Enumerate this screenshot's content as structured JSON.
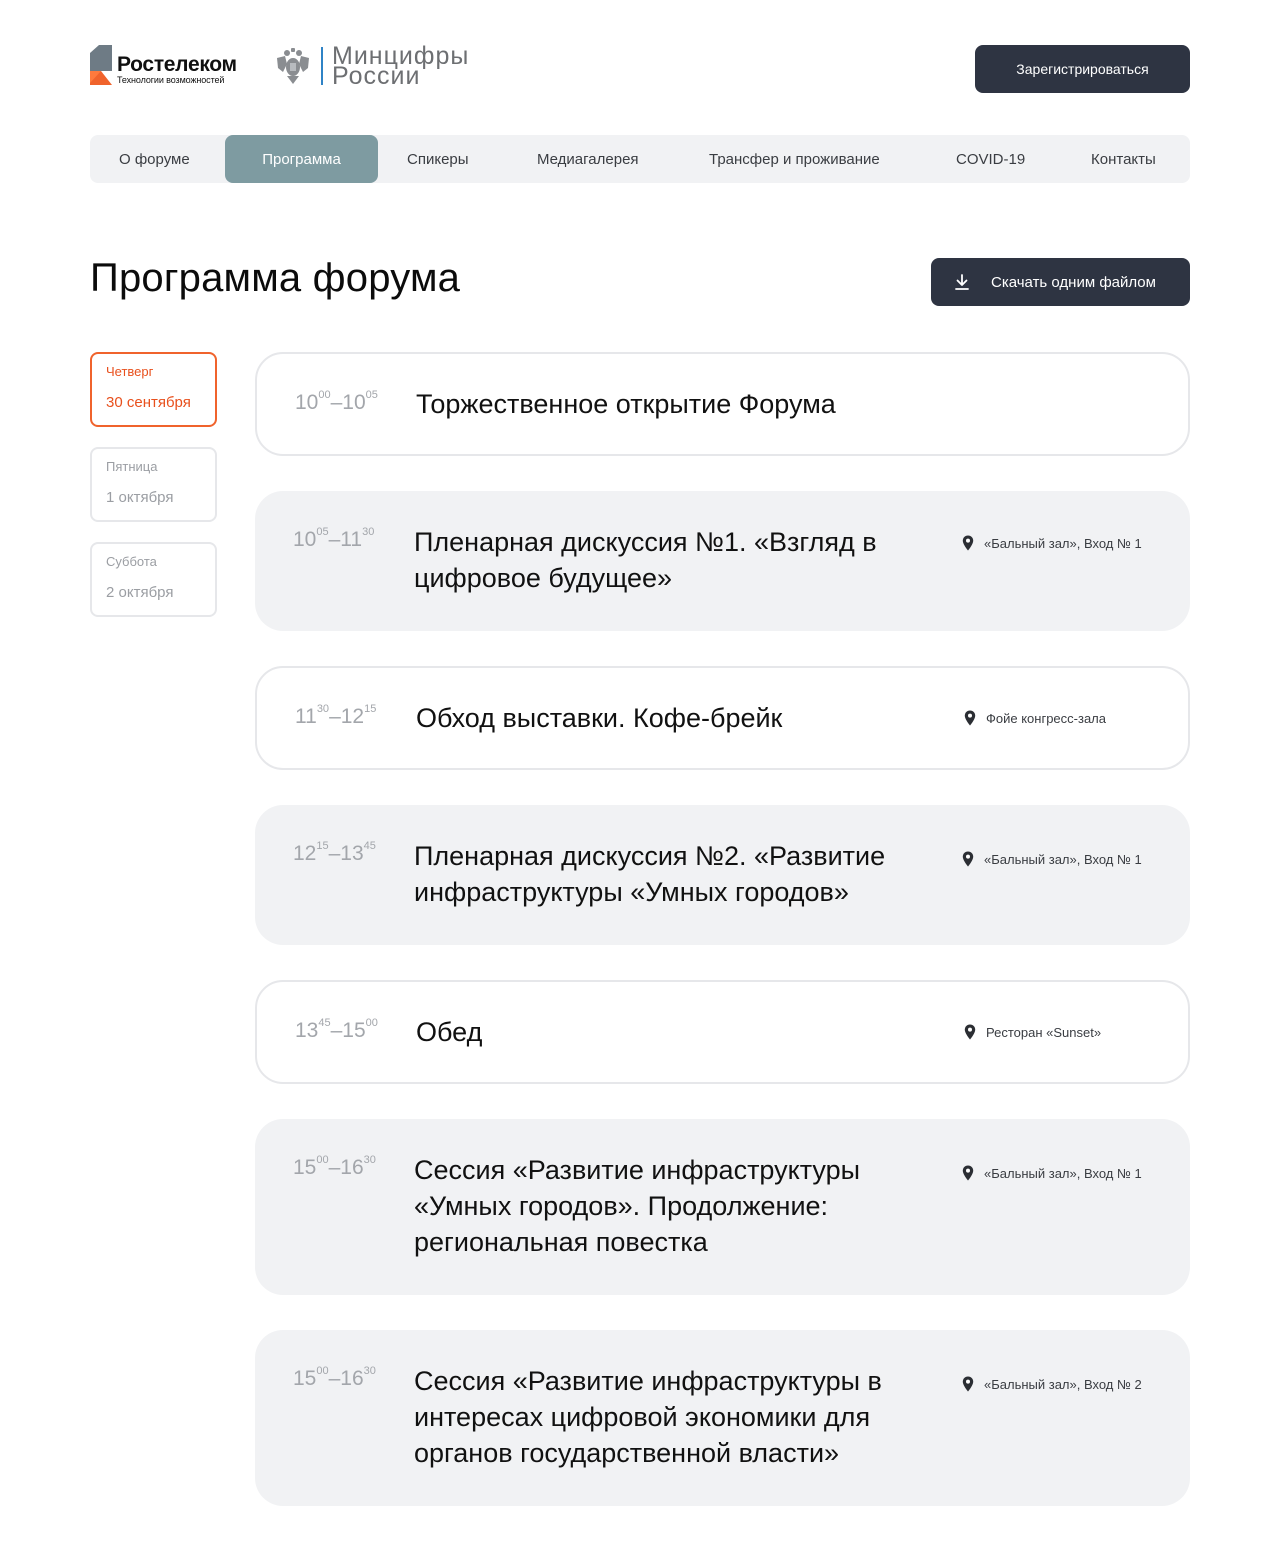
{
  "header": {
    "brand_name": "Ростелеком",
    "brand_tagline": "Технологии возможностей",
    "ministry_line1": "Минцифры",
    "ministry_line2": "России",
    "register_label": "Зарегистрироваться"
  },
  "nav": {
    "items": [
      {
        "label": "О форуме",
        "active": false
      },
      {
        "label": "Программа",
        "active": true
      },
      {
        "label": "Спикеры",
        "active": false
      },
      {
        "label": "Медиагалерея",
        "active": false
      },
      {
        "label": "Трансфер и проживание",
        "active": false
      },
      {
        "label": "COVID-19",
        "active": false
      },
      {
        "label": "Контакты",
        "active": false
      }
    ]
  },
  "page": {
    "title": "Программа форума",
    "download_label": "Скачать одним файлом"
  },
  "days": [
    {
      "weekday": "Четверг",
      "date": "30 сентября",
      "active": true
    },
    {
      "weekday": "Пятница",
      "date": "1 октября",
      "active": false
    },
    {
      "weekday": "Суббота",
      "date": "2 октября",
      "active": false
    }
  ],
  "events": [
    {
      "start_h": "10",
      "start_m": "00",
      "end_h": "10",
      "end_m": "05",
      "title": "Торжественное открытие Форума",
      "location": "",
      "style": "outlined"
    },
    {
      "start_h": "10",
      "start_m": "05",
      "end_h": "11",
      "end_m": "30",
      "title": "Пленарная дискуссия №1. «Взгляд в цифровое будущее»",
      "location": "«Бальный зал», Вход № 1",
      "style": "filled"
    },
    {
      "start_h": "11",
      "start_m": "30",
      "end_h": "12",
      "end_m": "15",
      "title": "Обход выставки. Кофе-брейк",
      "location": "Фойе конгресс-зала",
      "style": "outlined"
    },
    {
      "start_h": "12",
      "start_m": "15",
      "end_h": "13",
      "end_m": "45",
      "title": "Пленарная дискуссия №2. «Развитие инфраструктуры «Умных городов»",
      "location": "«Бальный зал», Вход № 1",
      "style": "filled"
    },
    {
      "start_h": "13",
      "start_m": "45",
      "end_h": "15",
      "end_m": "00",
      "title": "Обед",
      "location": "Ресторан «Sunset»",
      "style": "outlined"
    },
    {
      "start_h": "15",
      "start_m": "00",
      "end_h": "16",
      "end_m": "30",
      "title": "Сессия «Развитие инфраструктуры «Умных городов». Продолжение: региональная повестка",
      "location": "«Бальный зал», Вход № 1",
      "style": "filled"
    },
    {
      "start_h": "15",
      "start_m": "00",
      "end_h": "16",
      "end_m": "30",
      "title": "Сессия «Развитие инфраструктуры в интересах цифровой экономики для органов государственной власти»",
      "location": "«Бальный зал», Вход № 2",
      "style": "filled"
    }
  ],
  "colors": {
    "accent_orange": "#f0632c",
    "dark_button": "#2e3442",
    "nav_active": "#7e9ba1",
    "card_fill": "#f1f2f4"
  }
}
